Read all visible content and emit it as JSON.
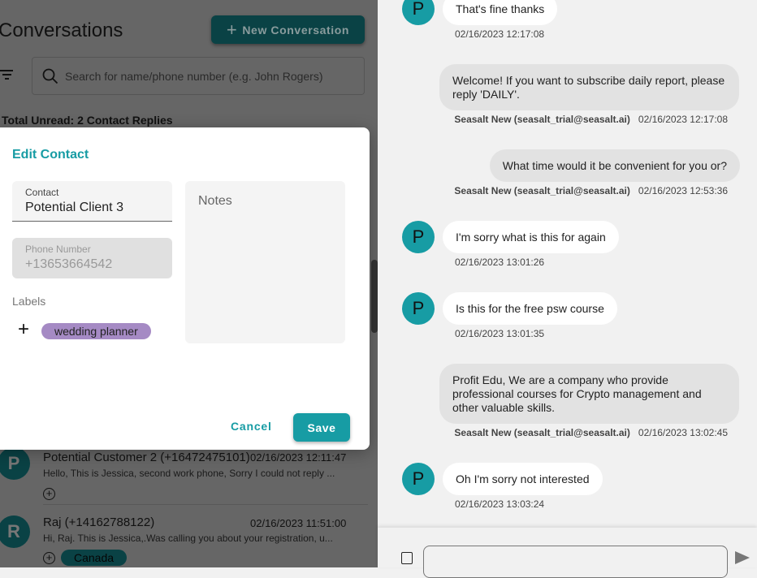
{
  "left": {
    "title": "Conversations",
    "new_button": "New Conversation",
    "search_placeholder": "Search for name/phone number (e.g. John Rogers)",
    "unread": "Total Unread: 2 Contact Replies",
    "conversations": [
      {
        "initial": "P",
        "name": "Potential Customer 2 (+16472475101)",
        "time": "02/16/2023 12:11:47",
        "preview": "Hello, This is Jessica, second work phone, Sorry I could not reply ..."
      },
      {
        "initial": "R",
        "name": "Raj (+14162788122)",
        "time": "02/16/2023 11:51:00",
        "preview": "Hi, Raj. This is Jessica,.Was calling you about your registration, u...",
        "label": "Canada"
      }
    ]
  },
  "modal": {
    "title": "Edit Contact",
    "contact_label": "Contact",
    "contact_value": "Potential Client 3",
    "phone_label": "Phone Number",
    "phone_value": "+13653664542",
    "notes_placeholder": "Notes",
    "labels_heading": "Labels",
    "label_chip": "wedding planner",
    "cancel": "Cancel",
    "save": "Save"
  },
  "chat": {
    "messages": [
      {
        "dir": "in",
        "initial": "P",
        "text": "That's fine thanks",
        "time": "02/16/2023 12:17:08"
      },
      {
        "dir": "out",
        "text": "Welcome! If you want to subscribe daily report, please reply 'DAILY'.",
        "sender": "Seasalt New (seasalt_trial@seasalt.ai)",
        "time": "02/16/2023 12:17:08"
      },
      {
        "dir": "out",
        "text": "What time would it be convenient for you or?",
        "sender": "Seasalt New (seasalt_trial@seasalt.ai)",
        "time": "02/16/2023 12:53:36"
      },
      {
        "dir": "in",
        "initial": "P",
        "text": "I'm sorry what is this for again",
        "time": "02/16/2023 13:01:26"
      },
      {
        "dir": "in",
        "initial": "P",
        "text": "Is this for the free psw course",
        "time": "02/16/2023 13:01:35"
      },
      {
        "dir": "out",
        "text": "Profit Edu, We are a company who provide professional courses for Crypto management and other valuable skills.",
        "sender": "Seasalt New (seasalt_trial@seasalt.ai)",
        "time": "02/16/2023 13:02:45"
      },
      {
        "dir": "in",
        "initial": "P",
        "text": "Oh I'm sorry not interested",
        "time": "02/16/2023 13:03:24"
      }
    ]
  }
}
